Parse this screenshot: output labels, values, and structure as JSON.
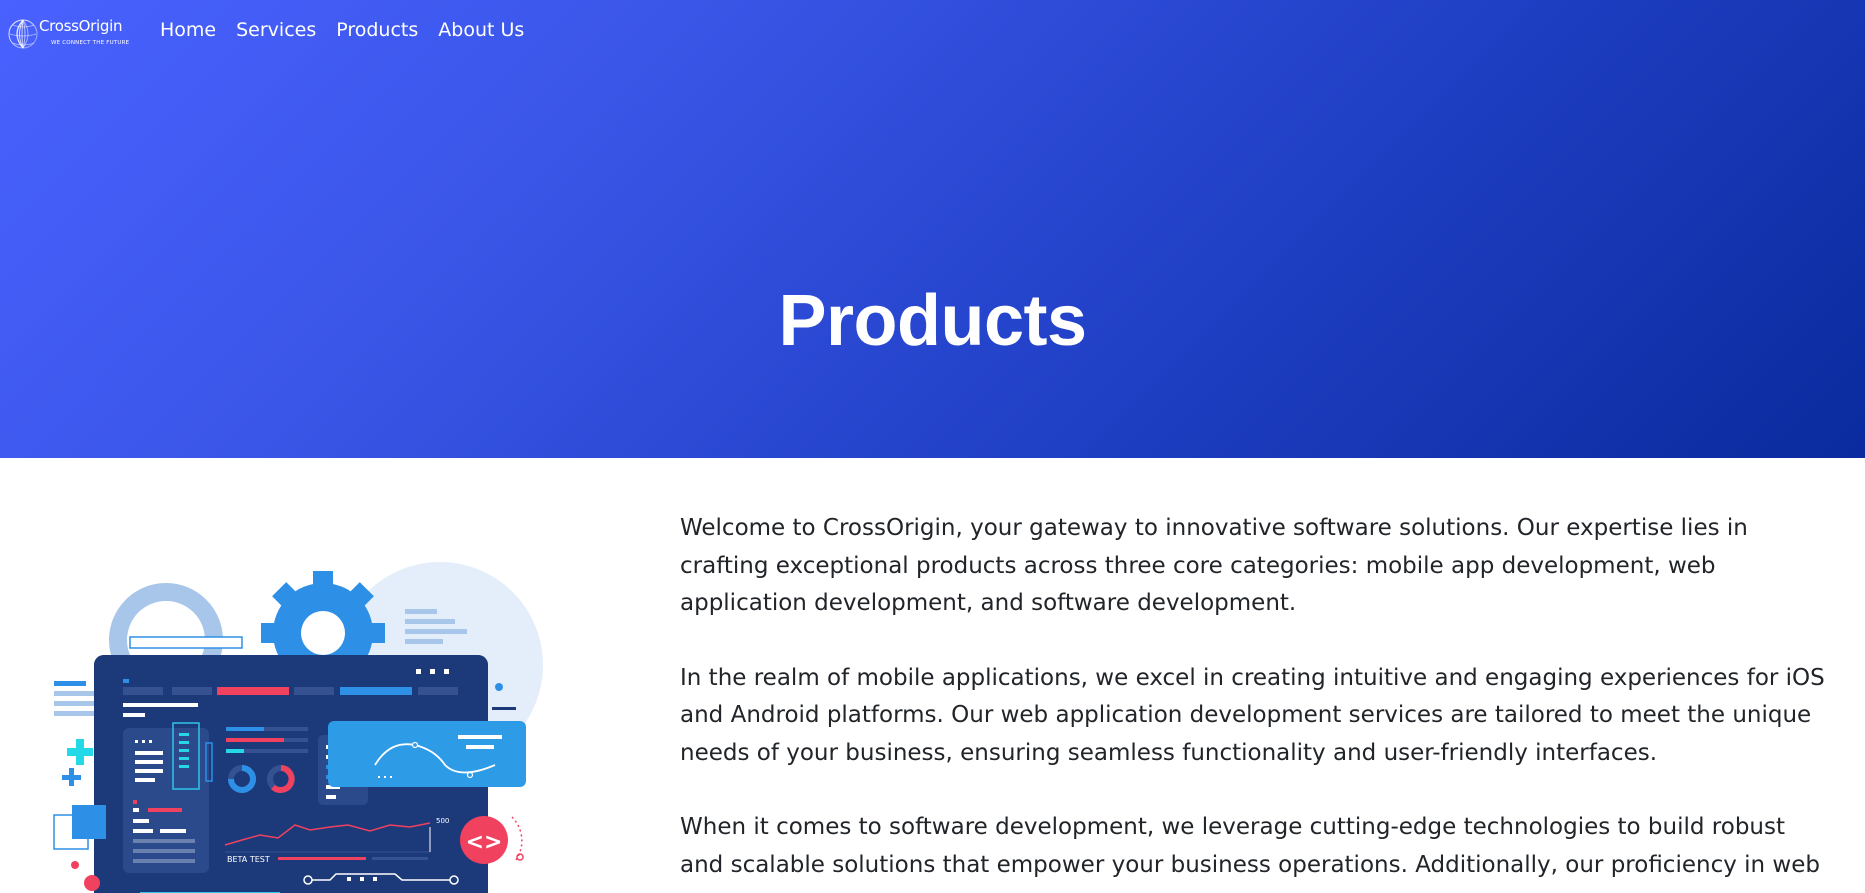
{
  "brand": {
    "name": "CrossOrigin",
    "tagline": "WE CONNECT THE FUTURE"
  },
  "nav": {
    "items": [
      {
        "label": "Home"
      },
      {
        "label": "Services"
      },
      {
        "label": "Products"
      },
      {
        "label": "About Us"
      }
    ]
  },
  "hero": {
    "title": "Products"
  },
  "illustration": {
    "beta_label": "BETA TEST",
    "value_label": "500",
    "code_glyph": "<>"
  },
  "content": {
    "paragraphs": [
      "Welcome to CrossOrigin, your gateway to innovative software solutions. Our expertise lies in crafting exceptional products across three core categories: mobile app development, web application development, and software development.",
      "In the realm of mobile applications, we excel in creating intuitive and engaging experiences for iOS and Android platforms. Our web application development services are tailored to meet the unique needs of your business, ensuring seamless functionality and user-friendly interfaces.",
      "When it comes to software development, we leverage cutting-edge technologies to build robust and scalable solutions that empower your business operations. Additionally, our proficiency in web"
    ]
  },
  "colors": {
    "hero_start": "#4961ff",
    "hero_end": "#0a2a9e",
    "dashboard_navy": "#1c3a7a",
    "accent_red": "#f0415f",
    "accent_cyan": "#25d8e8",
    "accent_blue": "#2e9be6"
  }
}
